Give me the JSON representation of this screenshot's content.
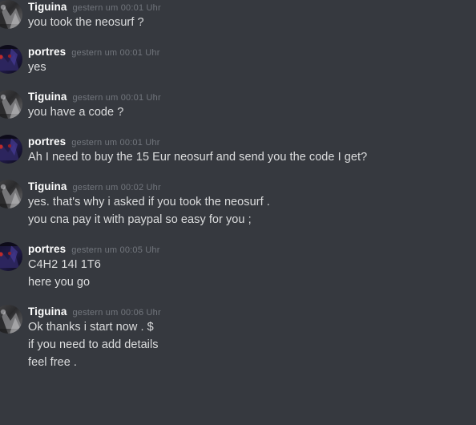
{
  "app": {
    "name": "discord-chat",
    "theme_background": "#36393f",
    "text_color": "#dcddde",
    "username_color": "#ffffff",
    "timestamp_color": "#72767d"
  },
  "messages": [
    {
      "id": "g0",
      "author": "Tiguina",
      "timestamp": "gestern um 00:01 Uhr",
      "avatar": "tiguina-avatar",
      "clipped": true,
      "lines": [
        "you took the neosurf ?"
      ]
    },
    {
      "id": "g1",
      "author": "portres",
      "timestamp": "gestern um 00:01 Uhr",
      "avatar": "portres-avatar",
      "clipped": false,
      "lines": [
        "yes"
      ]
    },
    {
      "id": "g2",
      "author": "Tiguina",
      "timestamp": "gestern um 00:01 Uhr",
      "avatar": "tiguina-avatar",
      "clipped": false,
      "lines": [
        "you have a code ?"
      ]
    },
    {
      "id": "g3",
      "author": "portres",
      "timestamp": "gestern um 00:01 Uhr",
      "avatar": "portres-avatar",
      "clipped": false,
      "lines": [
        "Ah I need to buy the 15 Eur neosurf and send you the code I get?"
      ]
    },
    {
      "id": "g4",
      "author": "Tiguina",
      "timestamp": "gestern um 00:02 Uhr",
      "avatar": "tiguina-avatar",
      "clipped": false,
      "lines": [
        "yes. that's why i asked if you took the neosurf .",
        "you cna pay it with paypal so easy for you ;"
      ]
    },
    {
      "id": "g5",
      "author": "portres",
      "timestamp": "gestern um 00:05 Uhr",
      "avatar": "portres-avatar",
      "clipped": false,
      "lines": [
        "C4H2 14I 1T6",
        "here you go"
      ]
    },
    {
      "id": "g6",
      "author": "Tiguina",
      "timestamp": "gestern um 00:06 Uhr",
      "avatar": "tiguina-avatar",
      "clipped": false,
      "lines": [
        "Ok thanks i start now . $",
        "if you need to add details",
        "feel free ."
      ]
    }
  ]
}
